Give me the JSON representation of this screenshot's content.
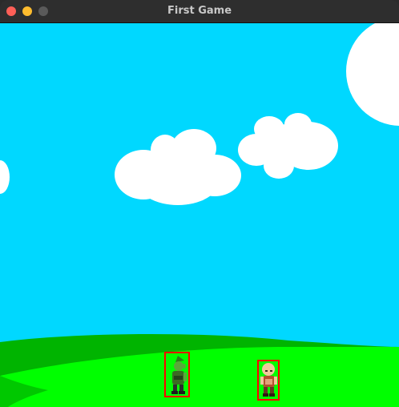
{
  "window": {
    "title": "First Game"
  },
  "scene": {
    "sky_color": "#00d8ff",
    "cloud_color": "#ffffff",
    "hill_dark_color": "#00b400",
    "hill_light_color": "#00ff00",
    "hitbox_color": "#ff0000",
    "characters": [
      {
        "name": "goblin",
        "icon": "goblin-sprite"
      },
      {
        "name": "knight",
        "icon": "bald-warrior-sprite"
      }
    ]
  }
}
